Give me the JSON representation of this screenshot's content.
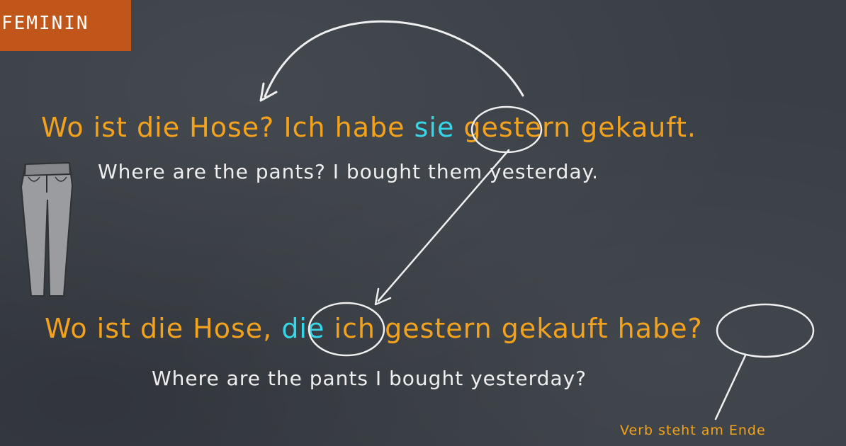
{
  "tag": "FEMININ",
  "sentence1": {
    "before": "Wo ist die Hose? Ich habe ",
    "pronoun": "sie",
    "after": " gestern gekauft."
  },
  "translation1": "Where are the pants? I bought them yesterday.",
  "sentence2": {
    "before": "Wo ist die Hose, ",
    "pronoun": "die",
    "middle": " ich gestern gekauft ",
    "verb": "habe?"
  },
  "translation2": "Where are the pants I bought yesterday?",
  "note": "Verb steht am Ende",
  "colors": {
    "background": "#3a3f46",
    "tag": "#c0561a",
    "german": "#f2a21c",
    "english": "#eeeeee",
    "pronoun": "#35d6e8"
  },
  "icons": [
    "pants-icon"
  ]
}
